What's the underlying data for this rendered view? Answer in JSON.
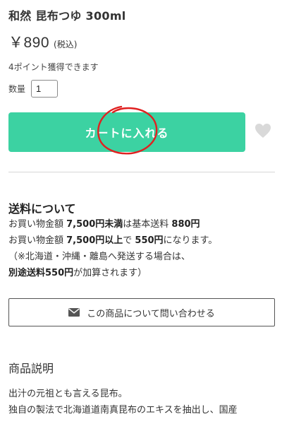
{
  "product": {
    "name": "和然 昆布つゆ 300ml",
    "price": "￥890",
    "tax_label": "(税込)",
    "points": "4ポイント獲得できます"
  },
  "quantity": {
    "label": "数量",
    "value": "1"
  },
  "cart_button": {
    "label": "カートに入れる",
    "color": "#3cd2a2"
  },
  "favorite": {
    "icon": "heart-icon",
    "color": "#d9d9d9"
  },
  "annotation": {
    "color": "#e02020"
  },
  "shipping": {
    "title": "送料について",
    "line1_a": "お買い物金額 ",
    "line1_b": "7,500円未満",
    "line1_c": "は基本送料 ",
    "line1_d": "880円",
    "line2_a": "お買い物金額 ",
    "line2_b": "7,500円以上",
    "line2_c": "で ",
    "line2_d": "550円",
    "line2_e": "になります。",
    "line3": "（※北海道・沖縄・離島へ発送する場合は、",
    "line4_a": "別途送料550円",
    "line4_b": "が加算されます）"
  },
  "inquiry_button": {
    "icon": "envelope-icon",
    "label": "この商品について問い合わせる"
  },
  "description": {
    "heading": "商品説明",
    "line1": "出汁の元祖とも言える昆布。",
    "line2": "独自の製法で北海道道南真昆布のエキスを抽出し、国産"
  }
}
